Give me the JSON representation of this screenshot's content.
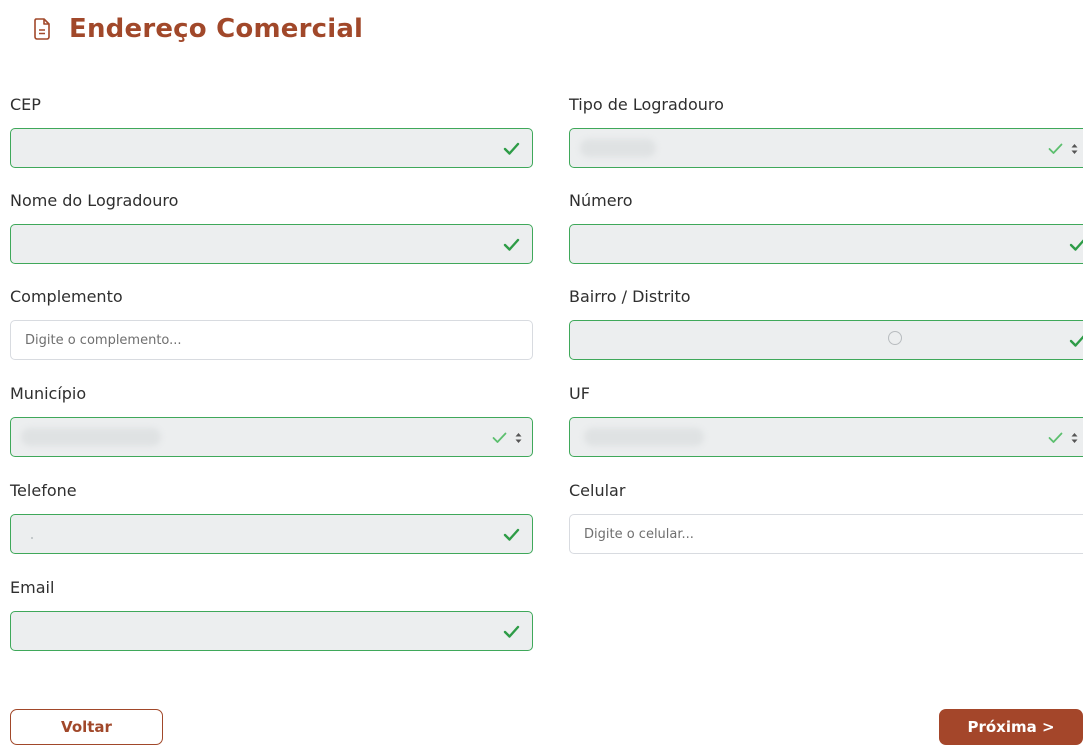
{
  "header": {
    "title": "Endereço Comercial",
    "icon": "document-icon"
  },
  "fields": {
    "cep": {
      "label": "CEP",
      "value": "",
      "status": "valid"
    },
    "tipo_logradouro": {
      "label": "Tipo de Logradouro",
      "value": "",
      "status": "valid",
      "control": "select"
    },
    "nome_logradouro": {
      "label": "Nome do Logradouro",
      "value": "",
      "status": "valid"
    },
    "numero": {
      "label": "Número",
      "value": "",
      "status": "valid"
    },
    "complemento": {
      "label": "Complemento",
      "value": "",
      "placeholder": "Digite o complemento...",
      "status": "empty"
    },
    "bairro": {
      "label": "Bairro / Distrito",
      "value": "",
      "status": "valid"
    },
    "municipio": {
      "label": "Município",
      "value": "",
      "status": "valid",
      "control": "select"
    },
    "uf": {
      "label": "UF",
      "value": "",
      "status": "valid",
      "control": "select"
    },
    "telefone": {
      "label": "Telefone",
      "value": "",
      "status": "valid"
    },
    "celular": {
      "label": "Celular",
      "value": "",
      "placeholder": "Digite o celular...",
      "status": "empty"
    },
    "email": {
      "label": "Email",
      "value": "",
      "status": "valid"
    }
  },
  "buttons": {
    "back_label": "Voltar",
    "next_label": "Próxima >"
  },
  "colors": {
    "brand": "#a1482a",
    "valid_border": "#3fa85a",
    "valid_fill": "#eceeef",
    "check": "#2e9c47"
  }
}
